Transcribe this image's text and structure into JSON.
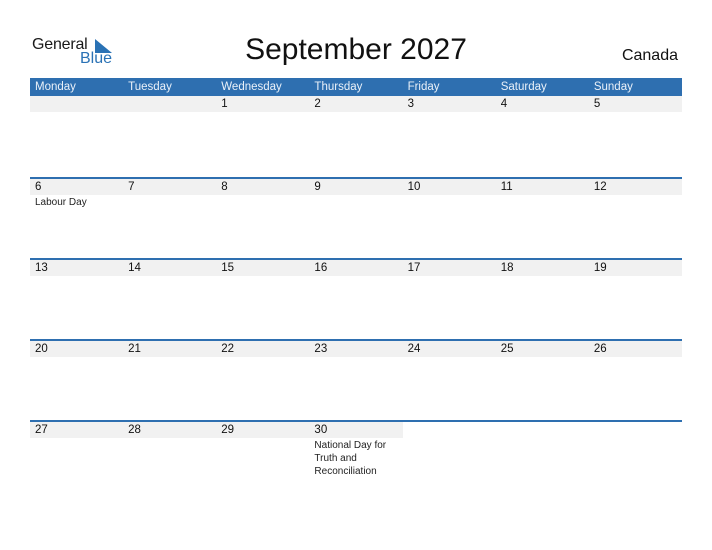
{
  "logo": {
    "line1": "General",
    "line2": "Blue"
  },
  "title": "September 2027",
  "country": "Canada",
  "weekdays": [
    "Monday",
    "Tuesday",
    "Wednesday",
    "Thursday",
    "Friday",
    "Saturday",
    "Sunday"
  ],
  "weeks": [
    [
      {
        "day": ""
      },
      {
        "day": ""
      },
      {
        "day": "1"
      },
      {
        "day": "2"
      },
      {
        "day": "3"
      },
      {
        "day": "4"
      },
      {
        "day": "5"
      }
    ],
    [
      {
        "day": "6",
        "holiday": "Labour Day"
      },
      {
        "day": "7"
      },
      {
        "day": "8"
      },
      {
        "day": "9"
      },
      {
        "day": "10"
      },
      {
        "day": "11"
      },
      {
        "day": "12"
      }
    ],
    [
      {
        "day": "13"
      },
      {
        "day": "14"
      },
      {
        "day": "15"
      },
      {
        "day": "16"
      },
      {
        "day": "17"
      },
      {
        "day": "18"
      },
      {
        "day": "19"
      }
    ],
    [
      {
        "day": "20"
      },
      {
        "day": "21"
      },
      {
        "day": "22"
      },
      {
        "day": "23"
      },
      {
        "day": "24"
      },
      {
        "day": "25"
      },
      {
        "day": "26"
      }
    ],
    [
      {
        "day": "27"
      },
      {
        "day": "28"
      },
      {
        "day": "29"
      },
      {
        "day": "30",
        "holiday": "National Day for Truth and Reconciliation"
      },
      {
        "day": "",
        "blank": true
      },
      {
        "day": "",
        "blank": true
      },
      {
        "day": "",
        "blank": true
      }
    ]
  ]
}
